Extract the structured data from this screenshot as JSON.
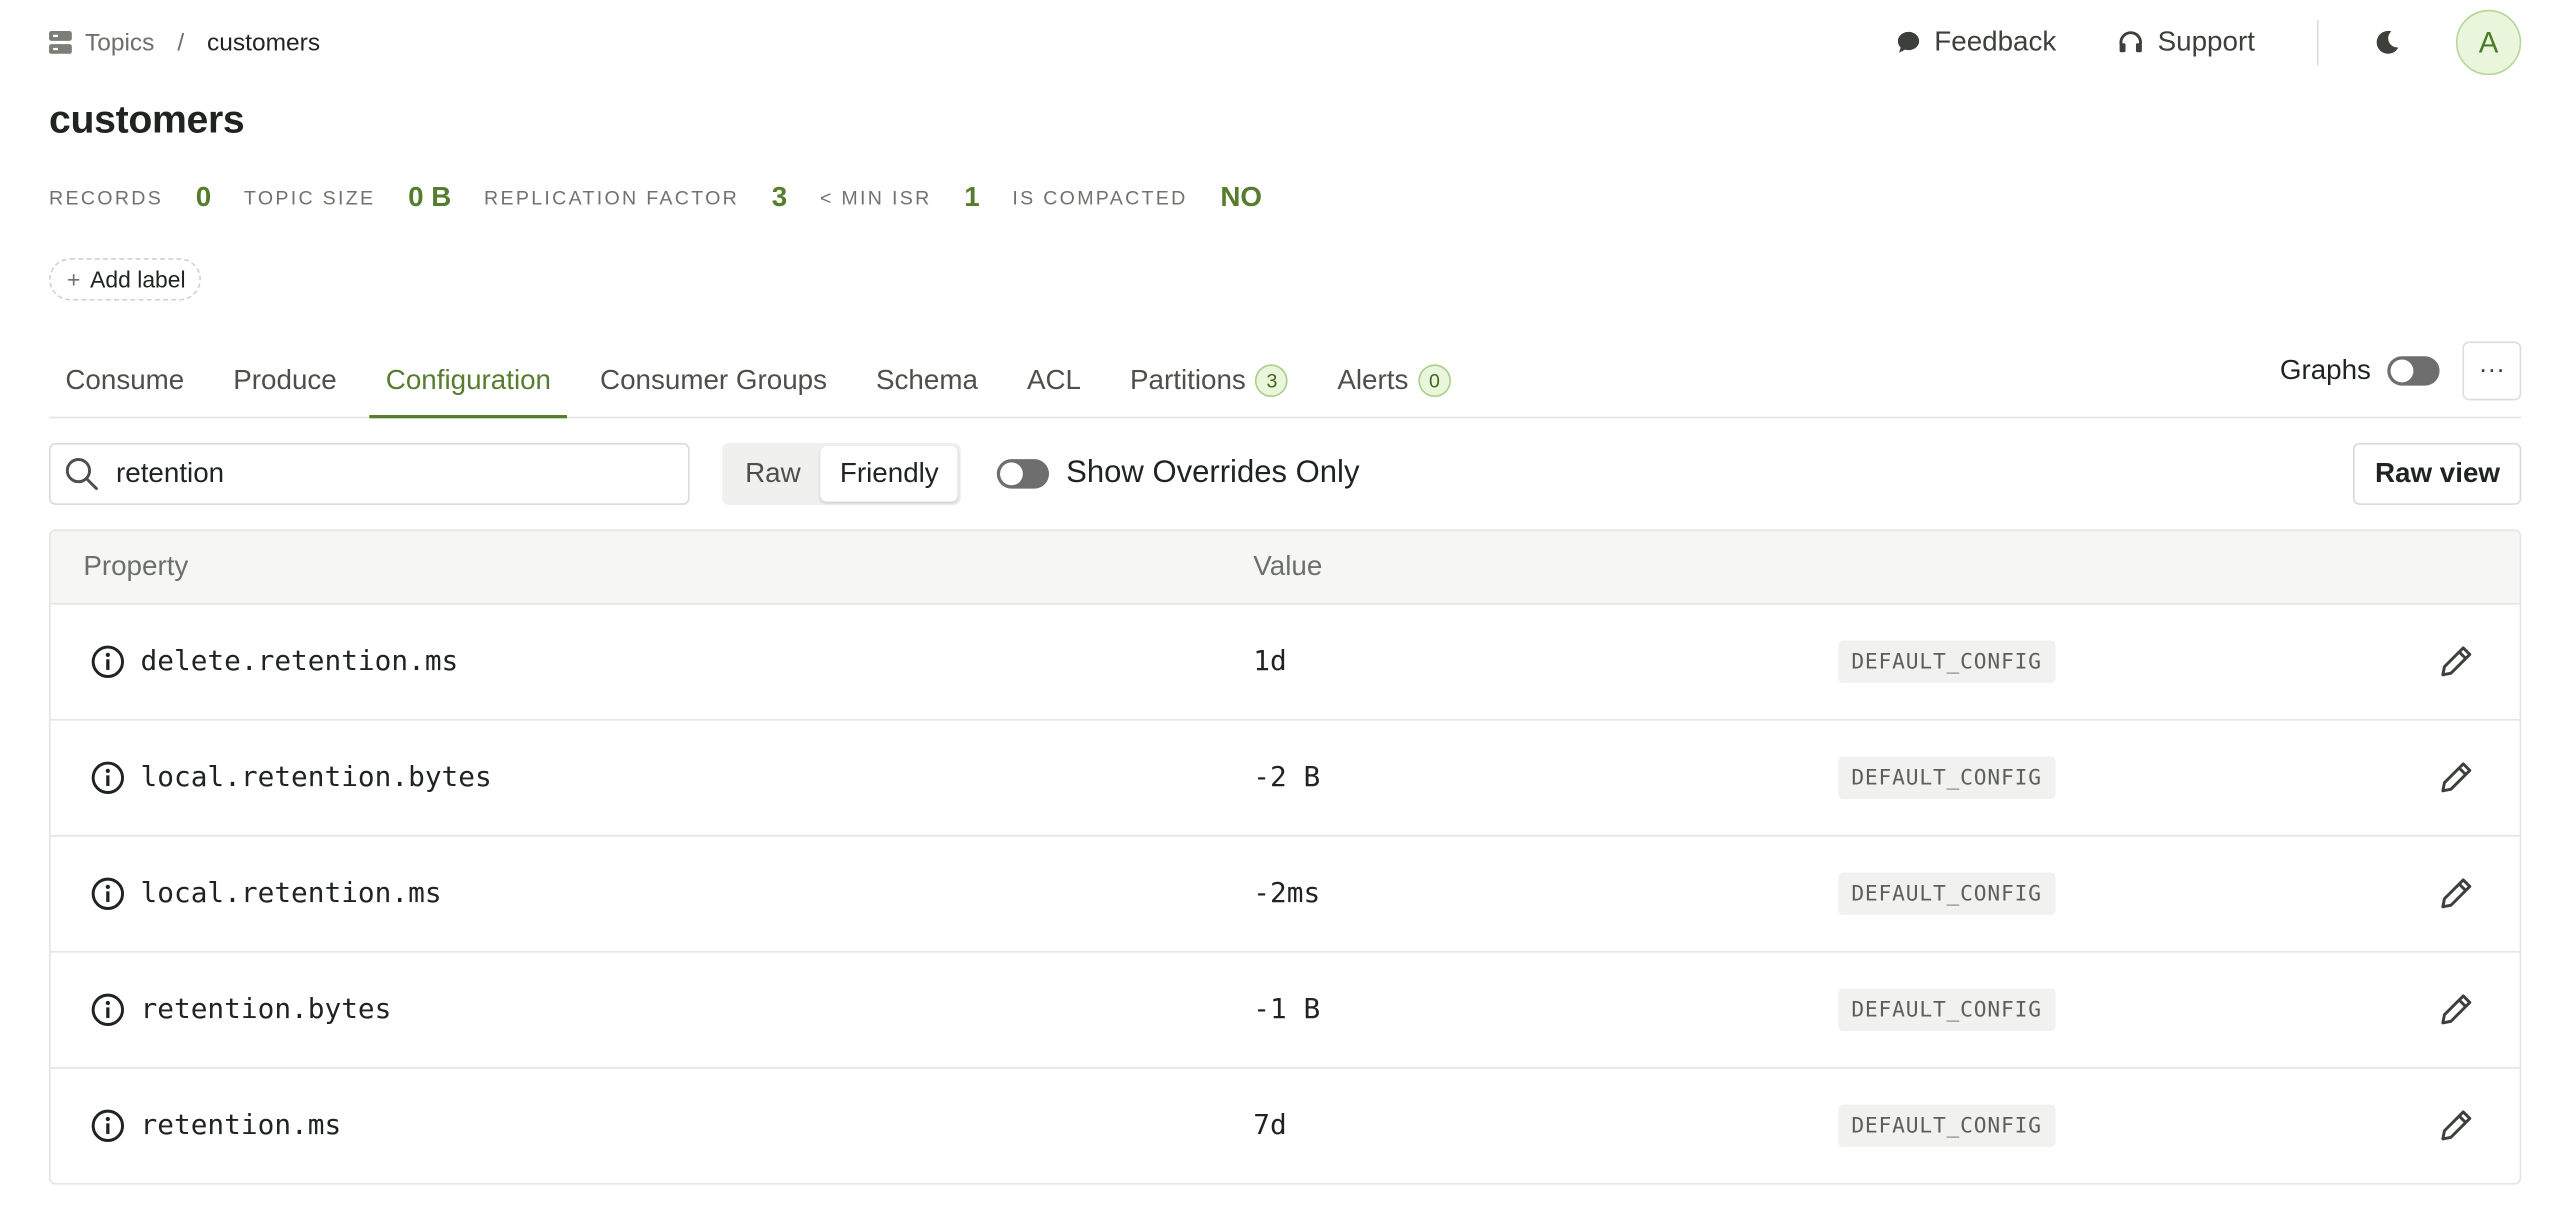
{
  "breadcrumb": {
    "parent": "Topics",
    "separator": "/",
    "current": "customers"
  },
  "header_actions": {
    "feedback": "Feedback",
    "support": "Support",
    "avatar_initial": "A"
  },
  "title": "customers",
  "stats": [
    {
      "label": "RECORDS",
      "value": "0"
    },
    {
      "label": "TOPIC SIZE",
      "value": "0 B"
    },
    {
      "label": "REPLICATION FACTOR",
      "value": "3"
    },
    {
      "label": "< MIN ISR",
      "value": "1"
    },
    {
      "label": "IS COMPACTED",
      "value": "NO"
    }
  ],
  "add_label": "Add label",
  "tabs": [
    {
      "label": "Consume"
    },
    {
      "label": "Produce"
    },
    {
      "label": "Configuration",
      "active": true
    },
    {
      "label": "Consumer Groups"
    },
    {
      "label": "Schema"
    },
    {
      "label": "ACL"
    },
    {
      "label": "Partitions",
      "badge": "3"
    },
    {
      "label": "Alerts",
      "badge": "0"
    }
  ],
  "graphs": {
    "label": "Graphs",
    "enabled": false
  },
  "more_label": "···",
  "toolbar": {
    "search_value": "retention",
    "mode_raw": "Raw",
    "mode_friendly": "Friendly",
    "mode_selected": "Friendly",
    "overrides_label": "Show Overrides Only",
    "overrides_enabled": false,
    "raw_view": "Raw view"
  },
  "table": {
    "headers": {
      "property": "Property",
      "value": "Value"
    },
    "rows": [
      {
        "property": "delete.retention.ms",
        "value": "1d",
        "source": "DEFAULT_CONFIG"
      },
      {
        "property": "local.retention.bytes",
        "value": "-2 B",
        "source": "DEFAULT_CONFIG"
      },
      {
        "property": "local.retention.ms",
        "value": "-2ms",
        "source": "DEFAULT_CONFIG"
      },
      {
        "property": "retention.bytes",
        "value": "-1 B",
        "source": "DEFAULT_CONFIG"
      },
      {
        "property": "retention.ms",
        "value": "7d",
        "source": "DEFAULT_CONFIG"
      }
    ]
  },
  "colors": {
    "accent": "#567d2d",
    "badge_bg": "#e9f6dc",
    "toggle_off": "#6e6e6e"
  },
  "icons": [
    "topics-icon",
    "feedback-icon",
    "support-icon",
    "moon-icon",
    "search-icon",
    "info-icon",
    "pencil-icon"
  ]
}
